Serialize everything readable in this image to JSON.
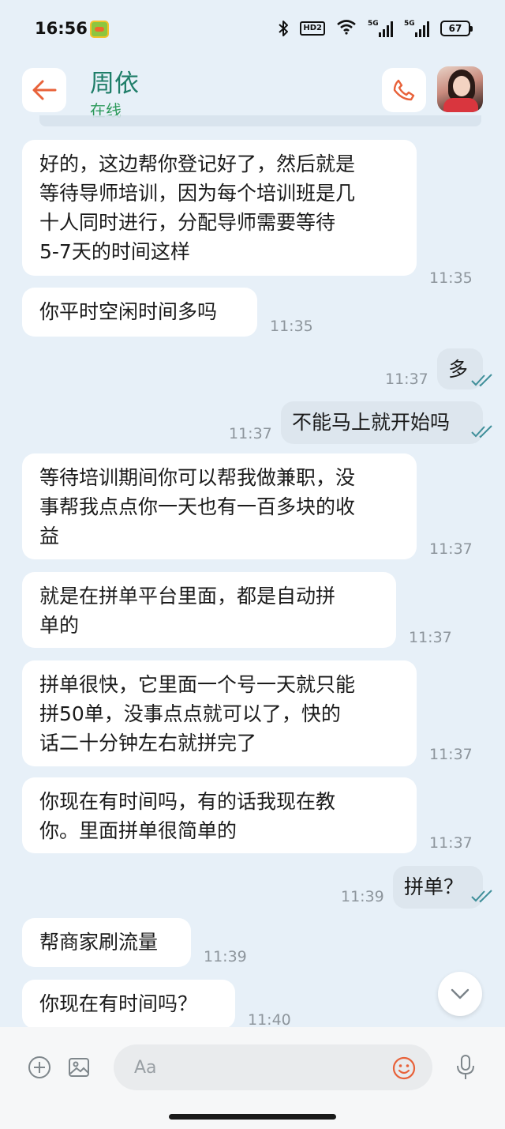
{
  "status_bar": {
    "time": "16:56",
    "hd_label": "HD2",
    "network_1": "5G",
    "network_2": "5G",
    "battery": "67"
  },
  "header": {
    "contact_name": "周依",
    "contact_status": "在线"
  },
  "messages": [
    {
      "dir": "in",
      "lines": [
        "好的，这边帮你登记好了，然后就是",
        "等待导师培训，因为每个培训班是几",
        "十人同时进行，分配导师需要等待",
        "5-7天的时间这样"
      ],
      "time": "11:35"
    },
    {
      "dir": "in",
      "lines": [
        "你平时空闲时间多吗"
      ],
      "time": "11:35"
    },
    {
      "dir": "out",
      "lines": [
        "多"
      ],
      "time": "11:37"
    },
    {
      "dir": "out",
      "lines": [
        "不能马上就开始吗"
      ],
      "time": "11:37"
    },
    {
      "dir": "in",
      "lines": [
        "等待培训期间你可以帮我做兼职，没",
        "事帮我点点你一天也有一百多块的收",
        "益"
      ],
      "time": "11:37"
    },
    {
      "dir": "in",
      "lines": [
        "就是在拼单平台里面，都是自动拼",
        "单的"
      ],
      "time": "11:37"
    },
    {
      "dir": "in",
      "lines": [
        "拼单很快，它里面一个号一天就只能",
        "拼50单，没事点点就可以了，快的",
        "话二十分钟左右就拼完了"
      ],
      "time": "11:37"
    },
    {
      "dir": "in",
      "lines": [
        "你现在有时间吗，有的话我现在教",
        "你。里面拼单很简单的"
      ],
      "time": "11:37"
    },
    {
      "dir": "out",
      "lines": [
        "拼单？"
      ],
      "time": "11:39"
    },
    {
      "dir": "in",
      "lines": [
        "帮商家刷流量"
      ],
      "time": "11:39"
    },
    {
      "dir": "in",
      "lines": [
        "你现在有时间吗？"
      ],
      "time": "11:40"
    }
  ],
  "composer": {
    "placeholder": "Aa"
  },
  "colors": {
    "accent": "#e8623a",
    "name": "#1f7e69",
    "online": "#2d9a5b",
    "chat_bg": "#e7f0f8",
    "tick": "#3f8f9a"
  }
}
